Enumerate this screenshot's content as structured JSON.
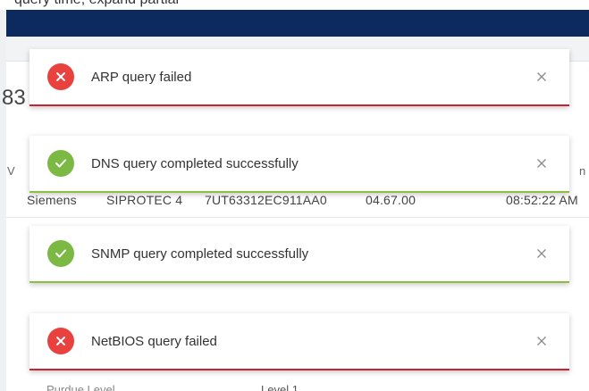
{
  "top_strip_text": "query time, expand partial",
  "colors": {
    "navbar": "#0d2a5f",
    "error": "#e8413e",
    "error_border": "#c82333",
    "success": "#7cb844",
    "success_border": "#8cbf3f"
  },
  "background": {
    "header_number": "83",
    "col_letter_left": "V",
    "col_letter_right": "n",
    "row": {
      "vendor": "Siemens",
      "model": "SIPROTEC 4",
      "order_number": "7UT63312EC911AA0",
      "firmware": "04.67.00",
      "time": "08:52:22 AM"
    },
    "detail_label": "Purdue Level",
    "detail_value": "Level 1"
  },
  "toasts": [
    {
      "status": "error",
      "icon": "error-x-icon",
      "message": "ARP query failed"
    },
    {
      "status": "success",
      "icon": "check-icon",
      "message": "DNS query completed successfully"
    },
    {
      "status": "success",
      "icon": "check-icon",
      "message": "SNMP query completed successfully"
    },
    {
      "status": "error",
      "icon": "error-x-icon",
      "message": "NetBIOS query failed"
    }
  ],
  "close_icon": "close-icon"
}
